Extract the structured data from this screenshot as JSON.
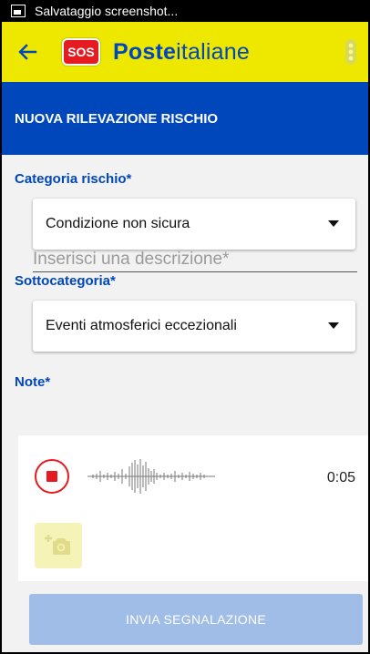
{
  "status_bar": {
    "text": "Salvataggio screenshot..."
  },
  "app_bar": {
    "back_icon": "arrow-left-icon",
    "sos_label": "SOS",
    "brand_bold": "Poste",
    "brand_regular": "italiane",
    "status_icon": "traffic-light-icon"
  },
  "header": {
    "title": "NUOVA RILEVAZIONE RISCHIO"
  },
  "form": {
    "categoria_label": "Categoria rischio*",
    "categoria_value": "Condizione non sicura",
    "sottocategoria_label": "Sottocategoria*",
    "sottocategoria_value": "Eventi atmosferici eccezionali",
    "note_label": "Note*",
    "note_placeholder": "Inserisci una descrizione*",
    "note_value": ""
  },
  "audio": {
    "timer": "0:05",
    "record_icon": "stop-record-icon",
    "camera_icon": "add-photo-icon"
  },
  "colors": {
    "accent_blue": "#0047bb",
    "brand_yellow": "#eee800",
    "sos_red": "#e61b22",
    "button_disabled": "#9fbde6"
  },
  "actions": {
    "submit_label": "INVIA SEGNALAZIONE"
  }
}
